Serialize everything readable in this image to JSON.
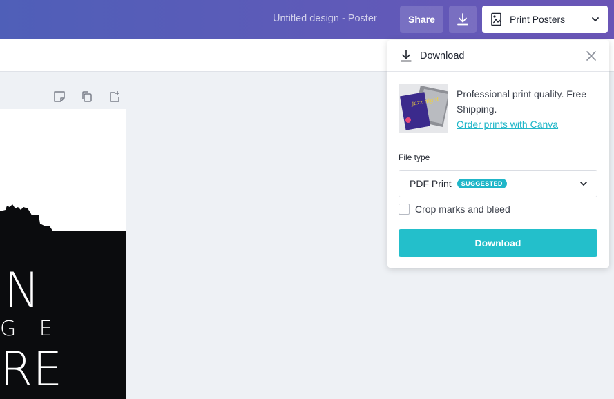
{
  "header": {
    "doc_title": "Untitled design - Poster",
    "share_label": "Share",
    "print_label": "Print Posters"
  },
  "poster": {
    "line1": "N",
    "line2": "G E",
    "line3": "RE"
  },
  "download_panel": {
    "title": "Download",
    "promo_text": "Professional print quality. Free Shipping.",
    "promo_link": "Order prints with Canva",
    "thumb_text": "jazz night",
    "file_type_label": "File type",
    "file_type_value": "PDF Print",
    "badge": "SUGGESTED",
    "crop_label": "Crop marks and bleed",
    "crop_checked": false,
    "download_button": "Download"
  },
  "colors": {
    "accent": "#23bfcb",
    "link": "#1fb6c8",
    "header_start": "#4f5fb8",
    "header_end": "#6a55b6"
  },
  "icons": [
    "download-icon",
    "print-icon",
    "chevron-down-icon",
    "close-icon",
    "note-icon",
    "copy-icon",
    "add-page-icon"
  ]
}
